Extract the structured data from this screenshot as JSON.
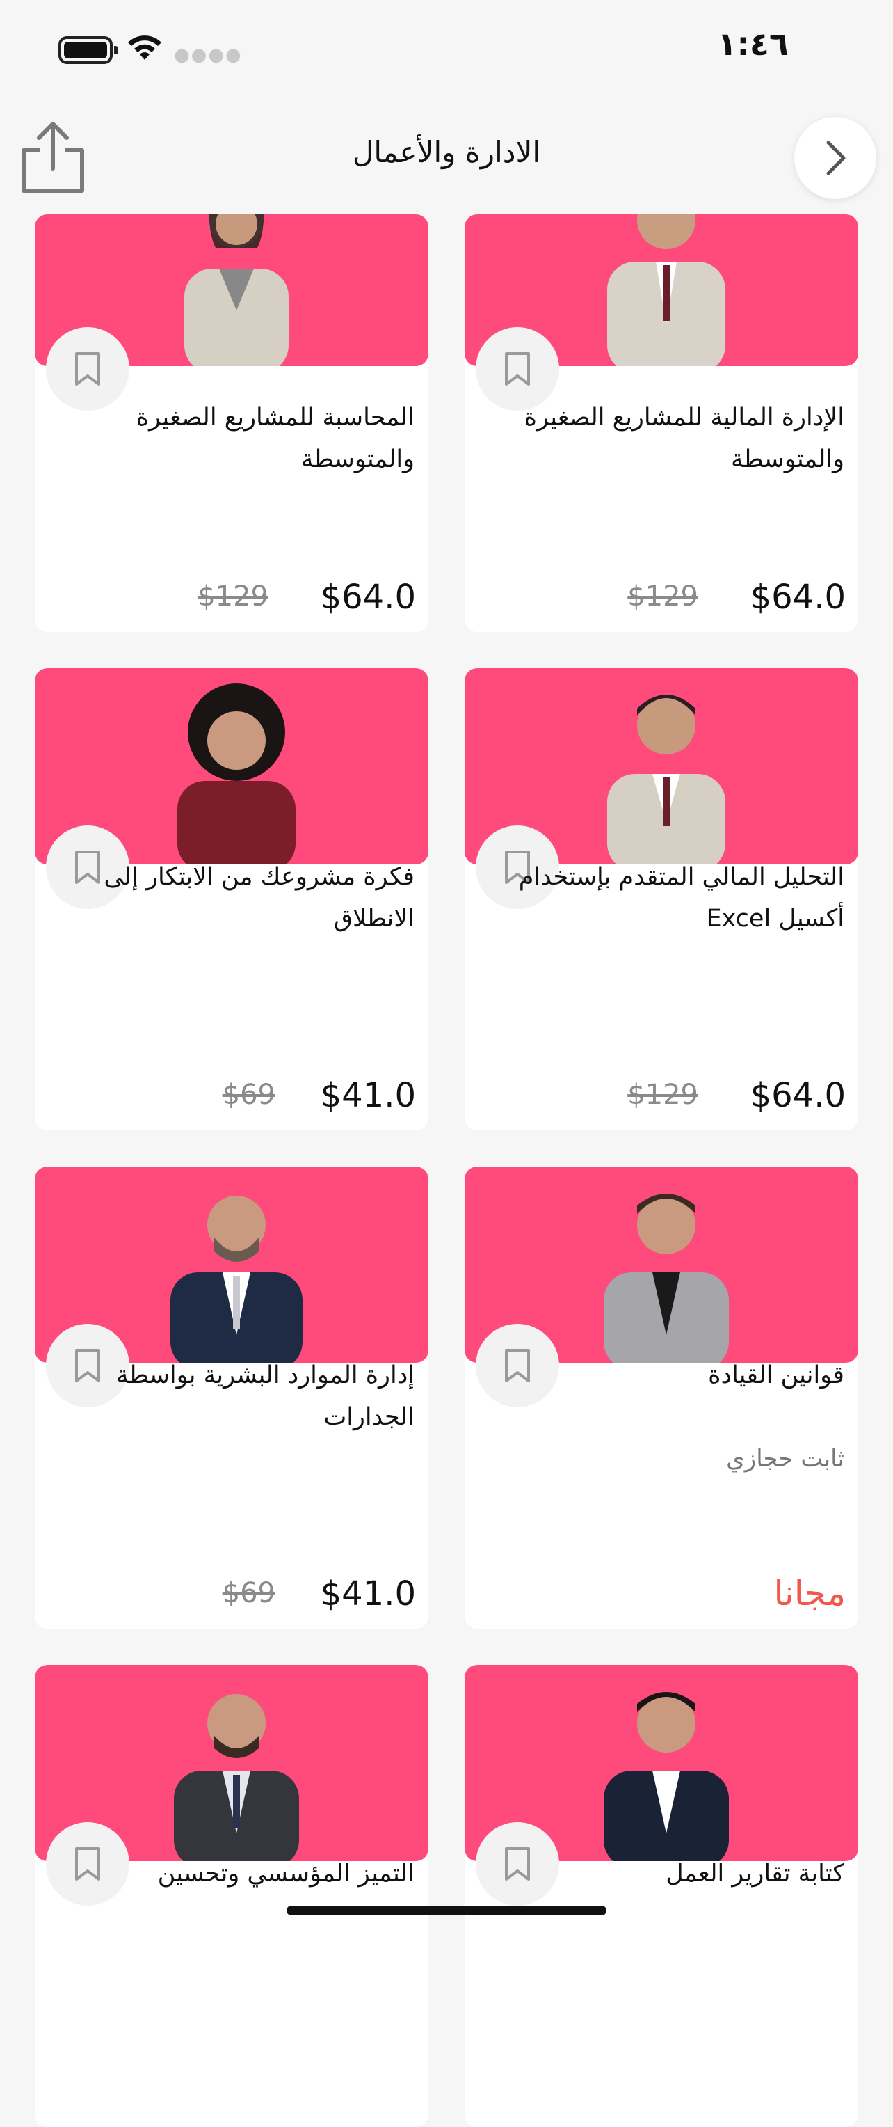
{
  "status_bar": {
    "time": "١:٤٦"
  },
  "nav": {
    "title": "الادارة والأعمال"
  },
  "colors": {
    "thumb_bg": "#ff4a7c",
    "free": "#f0584c",
    "old_price": "#8a8a8a"
  },
  "icons": {
    "share": "share-icon",
    "next": "chevron-right-icon",
    "bookmark": "bookmark-icon"
  },
  "courses": [
    {
      "title": "الإدارة المالية للمشاريع الصغيرة والمتوسطة",
      "price": "$64.0",
      "old_price": "$129"
    },
    {
      "title": "المحاسبة للمشاريع الصغيرة والمتوسطة",
      "price": "$64.0",
      "old_price": "$129"
    },
    {
      "title": "التحليل المالي المتقدم بإستخدام أكسيل Excel",
      "price": "$64.0",
      "old_price": "$129"
    },
    {
      "title": "فكرة مشروعك من الابتكار إلى الانطلاق",
      "price": "$41.0",
      "old_price": "$69"
    },
    {
      "title": "قوانين القيادة",
      "instructor": "ثابت حجازي",
      "free_label": "مجانا"
    },
    {
      "title": "إدارة الموارد البشرية بواسطة الجدارات",
      "price": "$41.0",
      "old_price": "$69"
    },
    {
      "title": "كتابة تقارير العمل"
    },
    {
      "title": "التميز المؤسسي وتحسين"
    }
  ]
}
